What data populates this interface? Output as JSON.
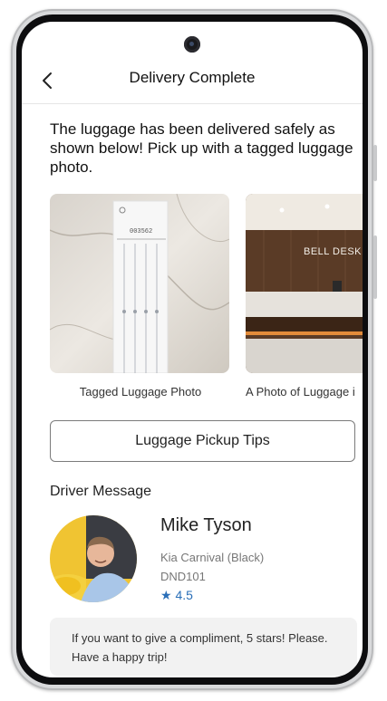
{
  "header": {
    "title": "Delivery Complete",
    "back_icon": "chevron-left-icon"
  },
  "headline": "The luggage has been delivered safely as shown below! Pick up with a tagged luggage photo.",
  "photos": [
    {
      "caption": "Tagged Luggage Photo",
      "tag_text": "003562"
    },
    {
      "caption": "A Photo of Luggage i",
      "sign_text": "BELL DESK"
    }
  ],
  "tips_button": "Luggage Pickup Tips",
  "driver_section_title": "Driver Message",
  "driver": {
    "name": "Mike Tyson",
    "car": "Kia Carnival (Black)",
    "plate": "DND101",
    "rating": "★ 4.5"
  },
  "message": "If you want to give a compliment, 5 stars! Please. Have a happy trip!",
  "colors": {
    "rating": "#2a6fb8",
    "message_bg": "#f2f2f2",
    "border": "#7b7b7b"
  }
}
